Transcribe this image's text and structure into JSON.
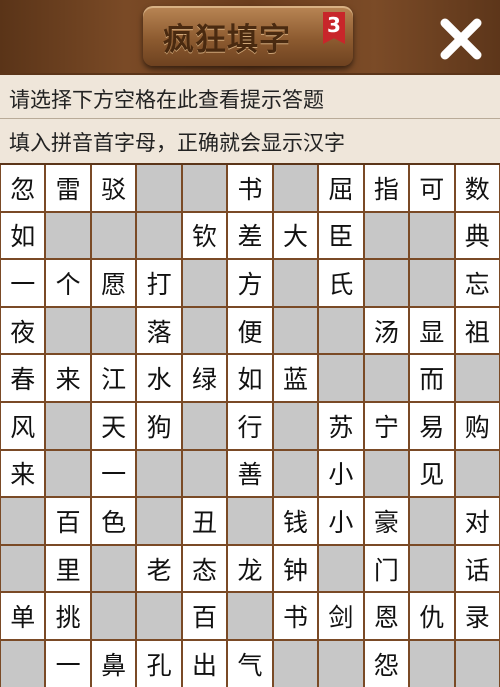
{
  "header": {
    "logo_text": "疯狂填字",
    "level_badge": "3",
    "close_symbol": "✕"
  },
  "hints": {
    "line1": "请选择下方空格在此查看提示答题",
    "line2": "填入拼音首字母，正确就会显示汉字"
  },
  "colors": {
    "wood_dark": "#5a3418",
    "cell_white": "#ffffff",
    "cell_blank": "#c7c7c7",
    "ribbon_red": "#c8262a"
  },
  "grid": {
    "rows": [
      [
        "忽",
        "雷",
        "驳",
        "",
        "",
        "书",
        "",
        "屈",
        "指",
        "可",
        "数"
      ],
      [
        "如",
        "",
        "",
        "",
        "钦",
        "差",
        "大",
        "臣",
        "",
        "",
        "典"
      ],
      [
        "一",
        "个",
        "愿",
        "打",
        "",
        "方",
        "",
        "氏",
        "",
        "",
        "忘"
      ],
      [
        "夜",
        "",
        "",
        "落",
        "",
        "便",
        "",
        "",
        "汤",
        "显",
        "祖"
      ],
      [
        "春",
        "来",
        "江",
        "水",
        "绿",
        "如",
        "蓝",
        "",
        "",
        "而",
        ""
      ],
      [
        "风",
        "",
        "天",
        "狗",
        "",
        "行",
        "",
        "苏",
        "宁",
        "易",
        "购"
      ],
      [
        "来",
        "",
        "一",
        "",
        "",
        "善",
        "",
        "小",
        "",
        "见",
        ""
      ],
      [
        "",
        "百",
        "色",
        "",
        "丑",
        "",
        "钱",
        "小",
        "豪",
        "",
        "对"
      ],
      [
        "",
        "里",
        "",
        "老",
        "态",
        "龙",
        "钟",
        "",
        "门",
        "",
        "话"
      ],
      [
        "单",
        "挑",
        "",
        "",
        "百",
        "",
        "书",
        "剑",
        "恩",
        "仇",
        "录"
      ],
      [
        "",
        "一",
        "鼻",
        "孔",
        "出",
        "气",
        "",
        "",
        "怨",
        "",
        ""
      ]
    ]
  }
}
